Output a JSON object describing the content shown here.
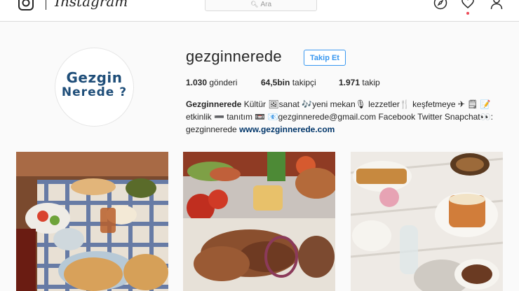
{
  "app": {
    "logo_text": "Instagram",
    "search_placeholder": "Ara",
    "icons": [
      "camera-logo-icon",
      "compass-icon",
      "heart-icon",
      "person-icon",
      "search-icon"
    ],
    "colors": {
      "accent": "#3897f0",
      "notification": "#ed4956",
      "brand_text": "#1f4e79"
    }
  },
  "profile": {
    "username": "gezginnerede",
    "follow_label": "Takip Et",
    "avatar_line1": "Gezgin",
    "avatar_line2": "Nerede ?",
    "stats": {
      "posts_count": "1.030",
      "posts_label": "gönderi",
      "followers_count": "64,5bin",
      "followers_label": "takipçi",
      "following_count": "1.971",
      "following_label": "takip"
    },
    "bio": {
      "name": "Gezginnerede",
      "line1": "Kültür 🖼sanat 🎶yeni mekan🎙 lezzetler🍴 keşfetmeye ✈ 🗒 📝",
      "line2": "etkinlik ➖ tanıtım 📼 📧gezginnerede@gmail.com Facebook Twitter Snapchat👀:",
      "line3": "gezginnerede",
      "website": "www.gezginnerede.com"
    }
  },
  "posts": [
    {
      "alt": "breakfast-spread-photo"
    },
    {
      "alt": "grilled-meat-platter-photo"
    },
    {
      "alt": "dessert-table-photo"
    }
  ]
}
